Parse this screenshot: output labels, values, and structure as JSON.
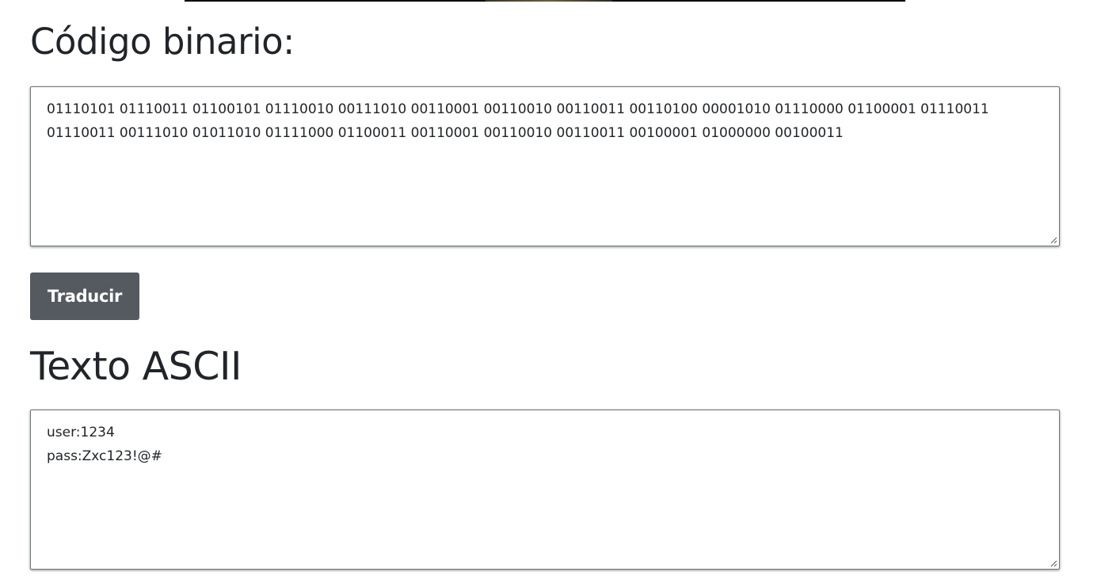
{
  "binary_section": {
    "heading": "Código binario:",
    "textarea_value": "01110101 01110011 01100101 01110010 00111010 00110001 00110010 00110011 00110100 00001010 01110000 01100001 01110011 01110011 00111010 01011010 01111000 01100011 00110001 00110010 00110011 00100001 01000000 00100011"
  },
  "actions": {
    "translate_label": "Traducir"
  },
  "ascii_section": {
    "heading": "Texto ASCII",
    "textarea_value": "user:1234\npass:Zxc123!@#"
  },
  "colors": {
    "button_bg": "#555a61",
    "text": "#212529",
    "border": "#6c757d"
  }
}
